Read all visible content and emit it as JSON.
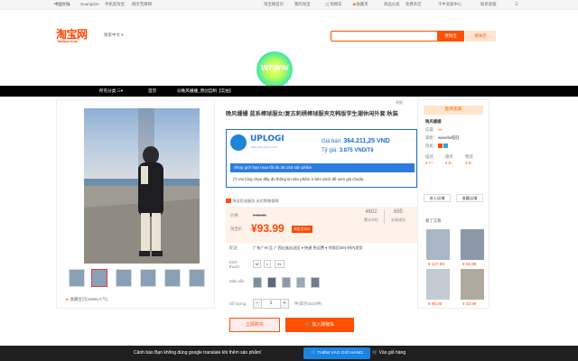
{
  "topbar": {
    "region": "中国大陆",
    "user": "Guangdon",
    "links_left": [
      "手机逛淘宝",
      "网页无障碍"
    ],
    "links_right": [
      "淘宝网首页",
      "我的淘宝",
      "购物车",
      "收藏夹",
      "商品分类",
      "免费开店",
      "千牛卖家中心",
      "联系客服"
    ]
  },
  "header": {
    "logo_main": "淘宝网",
    "logo_sub": "Taobao.com",
    "header_link": "搜索中文 ▾",
    "search_placeholder": "",
    "search_button": "搜淘宝",
    "search_ext": "搜本店",
    "shop_logo_text": "WFWW"
  },
  "navbar": {
    "items": [
      "所有分类",
      "首页",
      "@晚风姗姗_原创自制【实拍】"
    ]
  },
  "product": {
    "title": "晚风姗姗 蓝系棒球服女/复古刺绣棒球服夹克韩版学生潮休闲外套 秋装",
    "uplogi": {
      "brand": "UPLOGI",
      "brand_sub": "Mua hàng thông minh",
      "price_label": "Giá bán:",
      "price_value": "364.211,25 VND",
      "rate_label": "Tỷ giá:",
      "rate_value": "3.875 VND/Tệ",
      "promo": "Shop giới hạn mua tối đa 26.193 sản phẩm",
      "note": "(*) Vui lòng chọn đầy đủ thông tin sản phẩm ở bên dưới để xem giá chuẩn."
    },
    "badge_text": "淘宝优选服务 无忧购物保障",
    "price_label": "价格",
    "old_price": "¥ 98.99",
    "promo_label": "淘宝价",
    "price": "¥93.99",
    "price_tag": "淘宝活动价",
    "stat1_value": "4602",
    "stat1_label": "累计评价",
    "stat2_value": "685",
    "stat2_label": "交易成功",
    "ship_label": "配送",
    "ship_value": "广东广州 至 广西壮族自治区 ▾ 快递 免运费 ▾ 付款后48小时内发货",
    "size_label": "Kích thước",
    "sizes": [
      "M",
      "L",
      "XL"
    ],
    "color_label": "Màu sắc",
    "qty_label": "Số lượng",
    "qty_value": "1",
    "stock_text": "件(库存3416件)",
    "buy_button": "立即购买",
    "cart_button": "加入购物车",
    "collect": "收藏宝贝(15691人气)"
  },
  "shop_panel": {
    "header": "金牌卖家",
    "shop_name": "晚风姗姗",
    "rating_label": "信誉:",
    "rating_value": "♦♦",
    "contact_label": "掌柜:",
    "contact_value": "wwwifw旺旺",
    "quality_label": "资质:",
    "quality_value": "",
    "rating_rows": [
      {
        "label": "描述",
        "value": "4.7",
        "trend": "↑"
      },
      {
        "label": "服务",
        "value": "4.8",
        "trend": "↑"
      },
      {
        "label": "物流",
        "value": "4.8",
        "trend": "↑"
      }
    ],
    "enter_shop": "进入店铺",
    "follow_shop": "收藏店铺",
    "recommend_title": "看了又看",
    "recommend_prices": [
      "¥ 127.99",
      "¥ 53.99",
      "¥ 65.00",
      "¥ 43.99"
    ]
  },
  "footer": {
    "message": "Cảnh báo Bạn không dùng google translate khi thêm sản phẩm!",
    "add_button": "THÊM VÀO GIỎ HÀNG",
    "cart_link": "Vào giỏ hàng"
  },
  "colors": {
    "accent": "#ff5000",
    "price": "#ff4400",
    "uplogi_blue": "#1e6fcf",
    "footer_bg": "#1f1f1f",
    "footer_btn": "#1a84e3"
  }
}
